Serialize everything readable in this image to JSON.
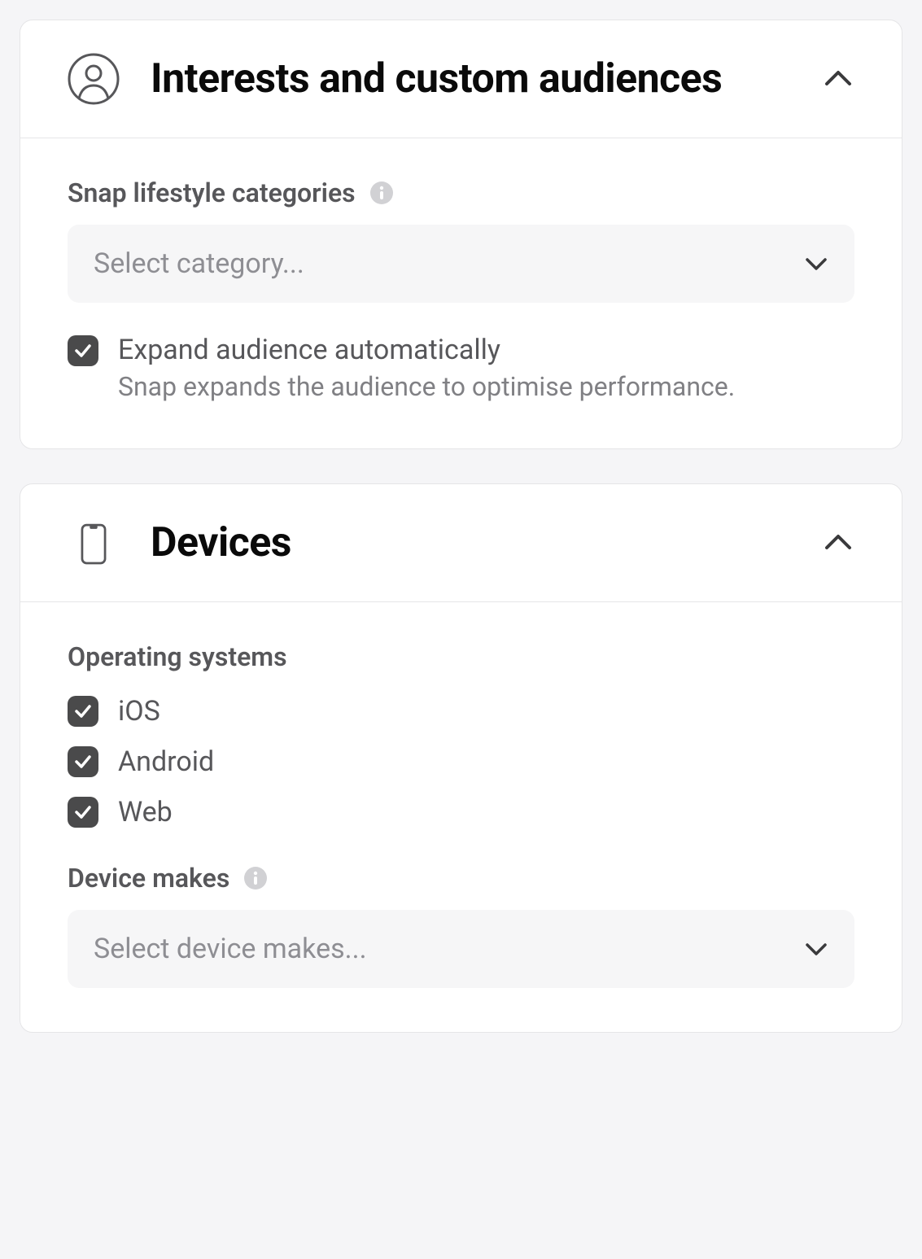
{
  "interests": {
    "title": "Interests and custom audiences",
    "lifestyleLabel": "Snap lifestyle categories",
    "lifestylePlaceholder": "Select category...",
    "expand": {
      "title": "Expand audience automatically",
      "description": "Snap expands the audience to optimise performance.",
      "checked": true
    }
  },
  "devices": {
    "title": "Devices",
    "osLabel": "Operating systems",
    "os": [
      {
        "label": "iOS",
        "checked": true
      },
      {
        "label": "Android",
        "checked": true
      },
      {
        "label": "Web",
        "checked": true
      }
    ],
    "makesLabel": "Device makes",
    "makesPlaceholder": "Select device makes..."
  }
}
